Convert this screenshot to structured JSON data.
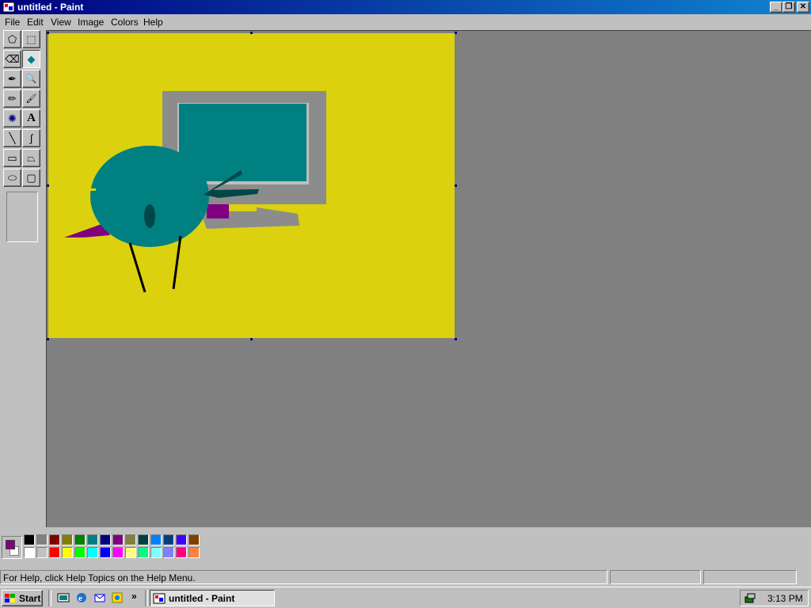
{
  "window": {
    "title": "untitled - Paint",
    "controls": {
      "minimize": "_",
      "restore": "❐",
      "close": "✕"
    }
  },
  "menu": [
    "File",
    "Edit",
    "View",
    "Image",
    "Colors",
    "Help"
  ],
  "tools": [
    {
      "name": "free-form-select-tool",
      "icon": "free-select-icon",
      "glyph": "⬠"
    },
    {
      "name": "select-tool",
      "icon": "rect-select-icon",
      "glyph": "⬚"
    },
    {
      "name": "eraser-tool",
      "icon": "eraser-icon",
      "glyph": "⌫"
    },
    {
      "name": "fill-tool",
      "icon": "paint-bucket-icon",
      "glyph": "◆",
      "active": true
    },
    {
      "name": "pick-color-tool",
      "icon": "eyedropper-icon",
      "glyph": "✒"
    },
    {
      "name": "magnifier-tool",
      "icon": "magnifier-icon",
      "glyph": "🔍"
    },
    {
      "name": "pencil-tool",
      "icon": "pencil-icon",
      "glyph": "✏"
    },
    {
      "name": "brush-tool",
      "icon": "brush-icon",
      "glyph": "🖌"
    },
    {
      "name": "airbrush-tool",
      "icon": "airbrush-icon",
      "glyph": "✺"
    },
    {
      "name": "text-tool",
      "icon": "text-a-icon",
      "glyph": "A"
    },
    {
      "name": "line-tool",
      "icon": "line-icon",
      "glyph": "╲"
    },
    {
      "name": "curve-tool",
      "icon": "curve-icon",
      "glyph": "∫"
    },
    {
      "name": "rectangle-tool",
      "icon": "rectangle-icon",
      "glyph": "▭"
    },
    {
      "name": "polygon-tool",
      "icon": "polygon-icon",
      "glyph": "⏢"
    },
    {
      "name": "ellipse-tool",
      "icon": "ellipse-icon",
      "glyph": "⬭"
    },
    {
      "name": "rounded-rectangle-tool",
      "icon": "rounded-rect-icon",
      "glyph": "▢"
    }
  ],
  "colors": {
    "canvas_bg": "#dcd10e",
    "workspace_bg": "#808080",
    "foreground": "#800080",
    "background": "#ffffff",
    "palette_top": [
      "#000000",
      "#808080",
      "#800000",
      "#808000",
      "#008000",
      "#008080",
      "#000080",
      "#800080",
      "#808040",
      "#004040",
      "#0080ff",
      "#004080",
      "#4000ff",
      "#804000"
    ],
    "palette_bottom": [
      "#ffffff",
      "#c0c0c0",
      "#ff0000",
      "#ffff00",
      "#00ff00",
      "#00ffff",
      "#0000ff",
      "#ff00ff",
      "#ffff80",
      "#00ff80",
      "#80ffff",
      "#8080ff",
      "#ff0080",
      "#ff8040"
    ]
  },
  "status": {
    "help_text": "For Help, click Help Topics on the Help Menu.",
    "pane2": "",
    "pane3": ""
  },
  "taskbar": {
    "start_label": "Start",
    "quick_launch": [
      "show-desktop-icon",
      "internet-explorer-icon",
      "outlook-express-icon",
      "channels-icon"
    ],
    "chevron": "»",
    "task_label": "untitled - Paint",
    "clock": "3:13 PM"
  }
}
